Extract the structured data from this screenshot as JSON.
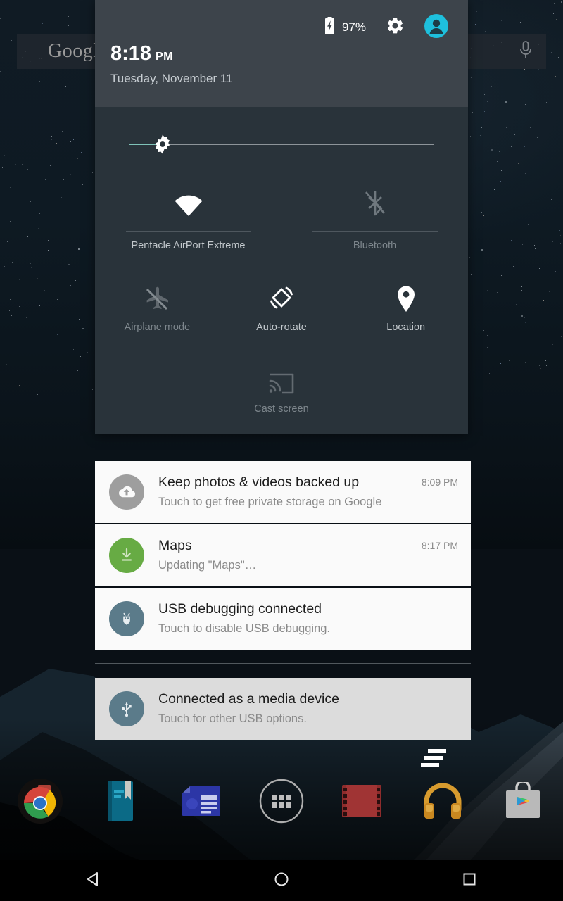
{
  "wallpaper": {
    "name": "night-sky-mountains"
  },
  "search": {
    "logo_text": "Google",
    "mic_icon": "microphone-icon"
  },
  "shade": {
    "header": {
      "battery": {
        "icon": "battery-charging-icon",
        "percent": "97%"
      },
      "settings_icon": "gear-icon",
      "user_icon": "user-avatar-icon",
      "time": "8:18",
      "time_ampm": "PM",
      "date": "Tuesday, November 11"
    },
    "brightness": {
      "label": "Brightness",
      "icon": "brightness-sun-icon",
      "value_percent": 8,
      "fill_color": "#7fc3b8",
      "track_color": "#8d9499"
    },
    "tiles": [
      {
        "id": "wifi",
        "icon": "wifi-icon",
        "label": "Pentacle AirPort Extreme",
        "state": "on"
      },
      {
        "id": "bluetooth",
        "icon": "bluetooth-off-icon",
        "label": "Bluetooth",
        "state": "off"
      },
      {
        "id": "airplane",
        "icon": "airplane-off-icon",
        "label": "Airplane mode",
        "state": "off"
      },
      {
        "id": "rotate",
        "icon": "auto-rotate-icon",
        "label": "Auto-rotate",
        "state": "on"
      },
      {
        "id": "location",
        "icon": "location-pin-icon",
        "label": "Location",
        "state": "on"
      },
      {
        "id": "cast",
        "icon": "cast-screen-icon",
        "label": "Cast screen",
        "state": "off"
      }
    ]
  },
  "notifications": {
    "items": [
      {
        "icon": "cloud-upload-icon",
        "icon_bg": "#9e9e9e",
        "title": "Keep photos & videos backed up",
        "sub": "Touch to get free private storage on Google",
        "time": "8:09 PM",
        "ongoing": false
      },
      {
        "icon": "download-arrow-icon",
        "icon_bg": "#67ab44",
        "title": "Maps",
        "sub": "Updating \"Maps\"…",
        "time": "8:17 PM",
        "ongoing": false
      },
      {
        "icon": "android-debug-icon",
        "icon_bg": "#5b7b8a",
        "title": "USB debugging connected",
        "sub": "Touch to disable USB debugging.",
        "time": "",
        "ongoing": false
      }
    ],
    "ongoing": [
      {
        "icon": "usb-icon",
        "icon_bg": "#5b7b8a",
        "title": "Connected as a media device",
        "sub": "Touch for other USB options.",
        "time": "",
        "ongoing": true
      }
    ],
    "clear_all_icon": "clear-all-icon"
  },
  "dock": {
    "items": [
      {
        "id": "chrome",
        "label": "Chrome",
        "icon": "chrome-icon"
      },
      {
        "id": "books",
        "label": "Play Books",
        "icon": "play-books-icon"
      },
      {
        "id": "newsstand",
        "label": "Play Newsstand",
        "icon": "play-newsstand-icon"
      },
      {
        "id": "all-apps",
        "label": "Apps",
        "icon": "app-drawer-icon"
      },
      {
        "id": "movies",
        "label": "Play Movies",
        "icon": "play-movies-icon"
      },
      {
        "id": "music",
        "label": "Play Music",
        "icon": "play-music-icon"
      },
      {
        "id": "store",
        "label": "Play Store",
        "icon": "play-store-icon"
      }
    ]
  },
  "navbar": {
    "items": [
      {
        "id": "back",
        "label": "Back",
        "icon": "back-triangle-icon"
      },
      {
        "id": "home",
        "label": "Home",
        "icon": "home-circle-icon"
      },
      {
        "id": "recents",
        "label": "Recents",
        "icon": "recents-square-icon"
      }
    ]
  },
  "colors": {
    "header_bg": "#3d444b",
    "qs_bg": "#29333a",
    "accent_cyan": "#1ec0dd",
    "notif_bg": "#fafafa",
    "notif_ongoing_bg": "#dcdcdc"
  }
}
